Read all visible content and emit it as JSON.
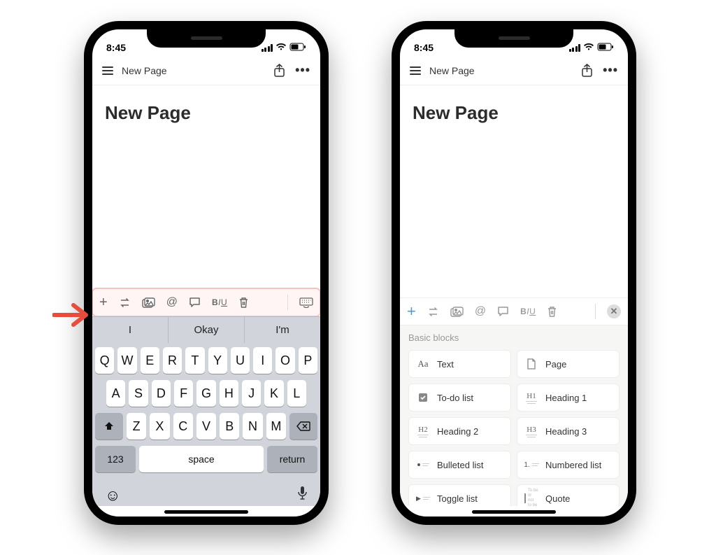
{
  "statusbar": {
    "time": "8:45"
  },
  "header": {
    "breadcrumb": "New Page"
  },
  "page": {
    "title": "New Page"
  },
  "toolbar": {
    "plus_label": "+",
    "mention_label": "@",
    "format_label_b": "B",
    "format_label_i": "I",
    "format_label_u": "U"
  },
  "keyboard": {
    "suggestions": [
      "I",
      "Okay",
      "I'm"
    ],
    "row1": [
      "Q",
      "W",
      "E",
      "R",
      "T",
      "Y",
      "U",
      "I",
      "O",
      "P"
    ],
    "row2": [
      "A",
      "S",
      "D",
      "F",
      "G",
      "H",
      "J",
      "K",
      "L"
    ],
    "row3": [
      "Z",
      "X",
      "C",
      "V",
      "B",
      "N",
      "M"
    ],
    "num_key": "123",
    "space_key": "space",
    "return_key": "return"
  },
  "blocks_panel": {
    "section_title": "Basic blocks",
    "items": [
      {
        "icon": "Aa",
        "label": "Text"
      },
      {
        "icon": "page",
        "label": "Page"
      },
      {
        "icon": "todo",
        "label": "To-do list"
      },
      {
        "icon": "H1",
        "label": "Heading 1"
      },
      {
        "icon": "H2",
        "label": "Heading 2"
      },
      {
        "icon": "H3",
        "label": "Heading 3"
      },
      {
        "icon": "bullet",
        "label": "Bulleted list"
      },
      {
        "icon": "1.",
        "label": "Numbered list"
      },
      {
        "icon": "toggle",
        "label": "Toggle list"
      },
      {
        "icon": "quote",
        "label": "Quote"
      }
    ]
  }
}
